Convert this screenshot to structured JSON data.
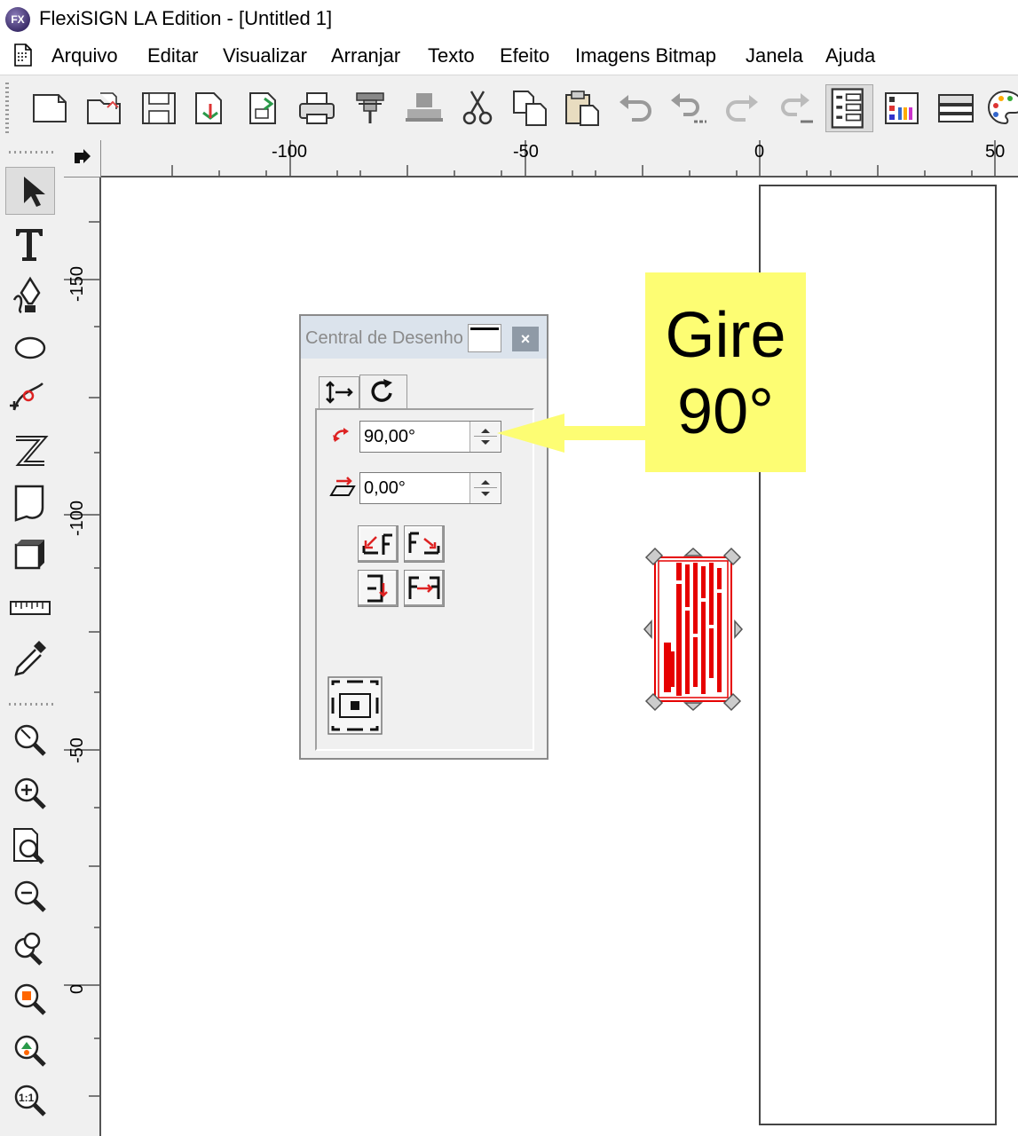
{
  "window": {
    "title": "FlexiSIGN LA Edition - [Untitled 1]",
    "logo": "FX"
  },
  "menu": [
    "Arquivo",
    "Editar",
    "Visualizar",
    "Arranjar",
    "Texto",
    "Efeito",
    "Imagens Bitmap",
    "Janela",
    "Ajuda"
  ],
  "toolbar": {
    "buttons": [
      "new-document-icon",
      "open-file-icon",
      "save-icon",
      "import-icon",
      "export-icon",
      "print-icon",
      "cutter-icon",
      "plotter-icon",
      "cut-icon",
      "copy-icon",
      "paste-icon",
      "undo-icon",
      "undo-list-icon",
      "redo-icon",
      "redo-list-icon",
      "coordinates-icon",
      "color-palette-list-icon",
      "layers-icon",
      "palette-icon"
    ]
  },
  "left_tools": [
    "select-arrow-icon",
    "text-tool-icon",
    "pen-tool-icon",
    "ellipse-tool-icon",
    "node-edit-icon",
    "distort-icon",
    "page-curl-icon",
    "3d-box-icon",
    "ruler-measure-icon",
    "eyedropper-icon",
    "zoom-custom-icon",
    "zoom-in-icon",
    "zoom-page-icon",
    "zoom-out-icon",
    "zoom-all-icon",
    "zoom-selection-icon",
    "zoom-previous-icon",
    "zoom-1to1-icon"
  ],
  "rulers": {
    "horizontal": [
      "-100",
      "-50",
      "0",
      "50"
    ],
    "vertical": [
      "-150",
      "-100",
      "-50",
      "0"
    ]
  },
  "dialog": {
    "title": "Central de Desenho",
    "close_label": "×",
    "rotation_value": "90,00°",
    "slant_value": "0,00°"
  },
  "callout": {
    "line1": "Gire",
    "line2": "90°"
  },
  "colors": {
    "selection": "#e60000",
    "callout": "#fdfd73",
    "dialog_title": "#dbe3ec"
  }
}
